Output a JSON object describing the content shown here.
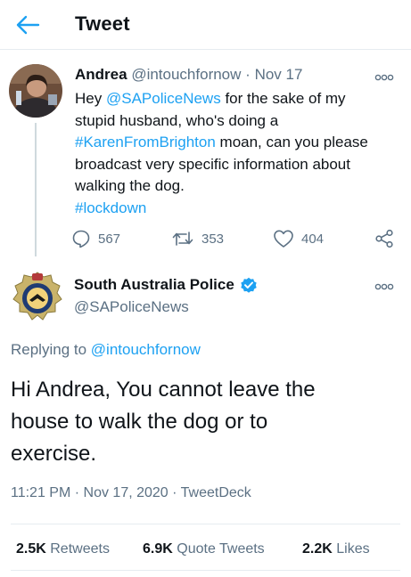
{
  "header": {
    "title": "Tweet",
    "back_icon": "arrow-left-icon",
    "accent": "#1da1f2"
  },
  "reply_tweet": {
    "name": "Andrea",
    "handle": "@intouchfornow",
    "separator": "·",
    "date": "Nov 17",
    "body": {
      "l1_a": "Hey ",
      "l1_mention": "@SAPoliceNews",
      "l1_b": " for the sake of my",
      "l2": "stupid husband, who's doing a",
      "l3_hashtag": "#KarenFromBrighton",
      "l3_b": " moan, can you please",
      "l4": "broadcast very specific information about",
      "l5": "walking the dog.",
      "l6_hashtag": "#lockdown"
    },
    "actions": {
      "replies": "567",
      "retweets": "353",
      "likes": "404"
    }
  },
  "main_tweet": {
    "name": "South Australia Police",
    "handle": "@SAPoliceNews",
    "replying_prefix": "Replying to ",
    "replying_handle": "@intouchfornow",
    "text": {
      "l1": "Hi Andrea, You cannot leave the",
      "l2": "house to walk the dog or to",
      "l3": "exercise."
    },
    "timestamp": "11:21 PM · Nov 17, 2020 · TweetDeck",
    "stats": {
      "retweets_num": "2.5K",
      "retweets_label": "Retweets",
      "quotes_num": "6.9K",
      "quotes_label": "Quote Tweets",
      "likes_num": "2.2K",
      "likes_label": "Likes"
    }
  }
}
